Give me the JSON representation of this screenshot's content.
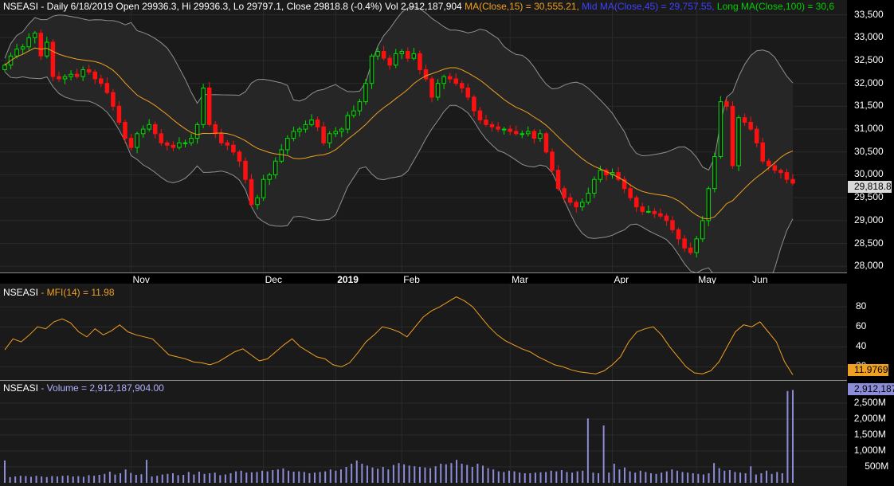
{
  "header": {
    "ticker": "NSEASI",
    "quote": " - Daily 6/18/2019 Open 29936.3, Hi 29936.3, Lo 29797.1, Close 29818.8 (-0.4%) Vol 2,912,187,904",
    "ma15": " MA(Close,15) = 30,555.21,",
    "ma45": " Mid MA(Close,45) = 29,757.55,",
    "ma100": " Long MA(Close,100) = 30,6"
  },
  "colors": {
    "up": "#00e000",
    "down": "#ff1010",
    "ma": "#f0a020",
    "band": "#909090",
    "mfi": "#f0a020",
    "volume": "#8c8cd8",
    "mid_ma": "#4040ff",
    "long_ma": "#00d000"
  },
  "price_axis": {
    "ticks": [
      "33,500",
      "33,000",
      "32,500",
      "32,000",
      "31,500",
      "31,000",
      "30,500",
      "30,000",
      "29,500",
      "29,000",
      "28,500",
      "28,000"
    ],
    "last_value": "29,818.8"
  },
  "time_axis": {
    "labels": [
      "Nov",
      "Dec",
      "2019",
      "Feb",
      "Mar",
      "Apr",
      "May",
      "Jun"
    ]
  },
  "mfi_panel": {
    "ticker": "NSEASI",
    "label": " - MFI(14) = 11.98",
    "ticks": [
      "80",
      "60",
      "40",
      "20"
    ],
    "last_value": "11.9769"
  },
  "volume_panel": {
    "ticker": "NSEASI",
    "label": " - Volume = 2,912,187,904.00",
    "ticks": [
      "2,500M",
      "2,000M",
      "1,500M",
      "1,000M",
      "500M"
    ],
    "last_value": "2,912,187"
  },
  "chart_data": [
    {
      "type": "line",
      "title": "NSEASI Daily",
      "series": [
        {
          "name": "Close",
          "values": [
            32400,
            32600,
            32750,
            32800,
            33000,
            33100,
            32600,
            32900,
            32150,
            32100,
            32150,
            32200,
            32150,
            32300,
            32250,
            32100,
            32000,
            31800,
            31500,
            31150,
            30800,
            30600,
            30900,
            31000,
            31100,
            30900,
            30700,
            30650,
            30600,
            30700,
            30700,
            30800,
            31100,
            31900,
            31100,
            30900,
            30700,
            30650,
            30500,
            30300,
            29900,
            29350,
            29500,
            29900,
            30000,
            30300,
            30550,
            30800,
            30950,
            31000,
            31100,
            31200,
            31050,
            30700,
            30900,
            30950,
            31000,
            31300,
            31400,
            31600,
            32000,
            32600,
            32700,
            32550,
            32400,
            32650,
            32700,
            32550,
            32650,
            32300,
            32100,
            31700,
            32000,
            32150,
            32100,
            32000,
            31900,
            31700,
            31400,
            31200,
            31100,
            31050,
            31000,
            31000,
            30950,
            30900,
            30900,
            30950,
            30800,
            30900,
            30500,
            30100,
            29700,
            29500,
            29400,
            29300,
            29400,
            29600,
            29900,
            30100,
            30000,
            30050,
            29900,
            29700,
            29500,
            29300,
            29200,
            29200,
            29150,
            29100,
            29000,
            28800,
            28600,
            28400,
            28300,
            28600,
            29000,
            29700,
            30400,
            31600,
            31500,
            30200,
            31250,
            31150,
            31000,
            30700,
            30300,
            30200,
            30100,
            30050,
            29900,
            29818.8
          ]
        },
        {
          "name": "MA(Close,15)",
          "values": [
            32600,
            32650,
            32700,
            32700,
            32650,
            32600,
            32500,
            32400,
            32300,
            32200,
            32100,
            32000,
            31900,
            31750,
            31600,
            31400,
            31200,
            31000,
            30850,
            30750,
            30700,
            30700,
            30700,
            30750,
            30800,
            30900,
            31000,
            31000,
            30950,
            30850,
            30700,
            30600,
            30500,
            30450,
            30450,
            30500,
            30600,
            30700,
            30800,
            30900,
            30950,
            31100,
            31300,
            31500,
            31700,
            31900,
            32100,
            32250,
            32350,
            32350,
            32300,
            32200,
            32100,
            31950,
            31800,
            31650,
            31500,
            31350,
            31200,
            31050,
            30950,
            30850,
            30750,
            30600,
            30450,
            30250,
            30100,
            29950,
            29850,
            29750,
            29700,
            29650,
            29600,
            29500,
            29400,
            29250,
            29100,
            29000,
            28900,
            28950,
            29200,
            29550,
            29900,
            30200,
            30450,
            30600,
            30550
          ]
        }
      ],
      "ylim": [
        27900,
        33650
      ],
      "x_labels": [
        "Nov",
        "Dec",
        "2019",
        "Feb",
        "Mar",
        "Apr",
        "May",
        "Jun"
      ]
    },
    {
      "type": "line",
      "title": "MFI(14)",
      "series": [
        {
          "name": "MFI(14)",
          "values": [
            37,
            48,
            45,
            52,
            60,
            58,
            65,
            68,
            64,
            55,
            50,
            58,
            52,
            56,
            62,
            55,
            52,
            50,
            48,
            40,
            32,
            30,
            28,
            25,
            24,
            22,
            25,
            30,
            35,
            38,
            32,
            26,
            28,
            35,
            42,
            48,
            40,
            35,
            30,
            28,
            22,
            20,
            24,
            34,
            45,
            52,
            60,
            58,
            55,
            50,
            60,
            70,
            76,
            80,
            85,
            90,
            86,
            80,
            70,
            60,
            52,
            46,
            42,
            38,
            35,
            30,
            26,
            22,
            20,
            17,
            15,
            14,
            13,
            16,
            22,
            30,
            45,
            55,
            58,
            60,
            52,
            40,
            30,
            20,
            14,
            13,
            16,
            25,
            40,
            55,
            62,
            60,
            65,
            55,
            45,
            25,
            12
          ]
        }
      ],
      "ylim": [
        10,
        100
      ],
      "ticks": [
        20,
        40,
        60,
        80
      ]
    },
    {
      "type": "bar",
      "title": "Volume",
      "series": [
        {
          "name": "Volume",
          "unit": "M",
          "values": [
            700,
            180,
            200,
            220,
            210,
            190,
            220,
            200,
            180,
            210,
            200,
            220,
            230,
            200,
            210,
            190,
            240,
            220,
            250,
            280,
            350,
            260,
            300,
            420,
            310,
            250,
            270,
            720,
            200,
            220,
            260,
            280,
            300,
            240,
            250,
            340,
            260,
            350,
            280,
            300,
            320,
            240,
            260,
            300,
            360,
            380,
            320,
            330,
            340,
            380,
            360,
            400,
            420,
            450,
            380,
            350,
            360,
            340,
            300,
            320,
            340,
            360,
            420,
            380,
            420,
            500,
            600,
            700,
            600,
            540,
            480,
            440,
            500,
            420,
            560,
            620,
            580,
            540,
            520,
            500,
            480,
            460,
            520,
            600,
            580,
            620,
            720,
            600,
            560,
            500,
            600,
            540,
            460,
            420,
            360,
            340,
            380,
            360,
            320,
            300,
            300,
            320,
            330,
            340,
            380,
            360,
            400,
            340,
            320,
            360,
            380,
            2020,
            320,
            300,
            1800,
            320,
            600,
            420,
            480,
            360,
            320,
            380,
            340,
            300,
            280,
            320,
            360,
            420,
            380,
            340,
            320,
            300,
            280,
            260,
            300,
            620,
            460,
            380,
            400,
            340,
            320,
            300,
            520,
            260,
            300,
            380,
            280,
            340,
            300,
            2880,
            2912
          ]
        }
      ],
      "ylim": [
        0,
        3100
      ],
      "ticks": [
        500,
        1000,
        1500,
        2000,
        2500
      ]
    }
  ]
}
